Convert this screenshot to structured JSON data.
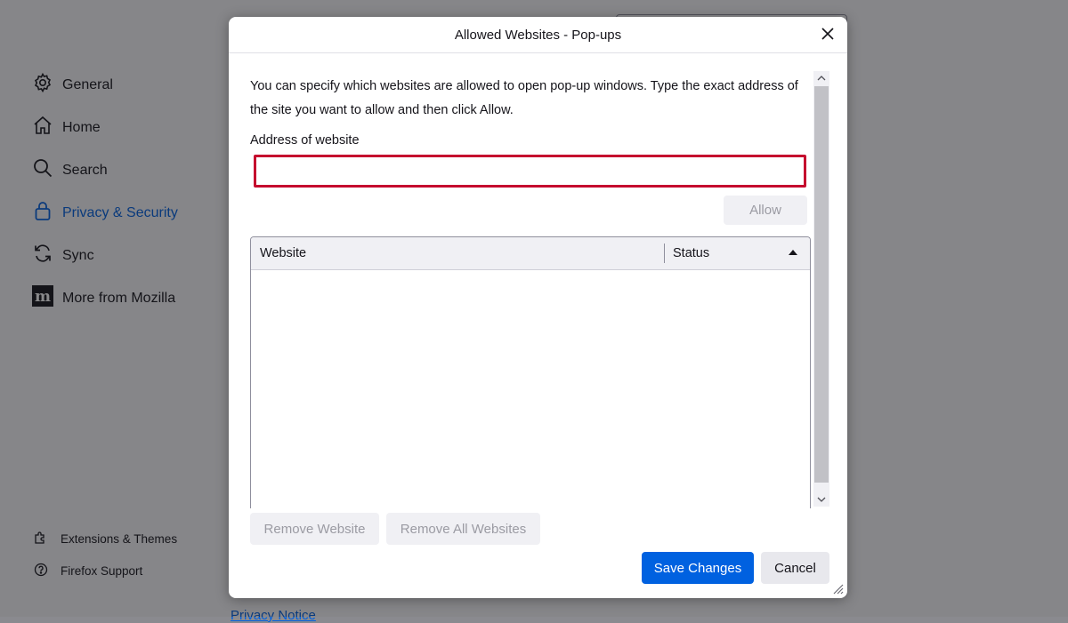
{
  "background": {
    "nav": {
      "items": [
        {
          "label": "General",
          "icon": "gear-icon"
        },
        {
          "label": "Home",
          "icon": "home-icon"
        },
        {
          "label": "Search",
          "icon": "search-icon"
        },
        {
          "label": "Privacy & Security",
          "icon": "lock-icon",
          "selected": true
        },
        {
          "label": "Sync",
          "icon": "sync-icon"
        },
        {
          "label": "More from Mozilla",
          "icon": "mozilla-icon"
        }
      ],
      "footer": [
        {
          "label": "Extensions & Themes",
          "icon": "puzzle-icon"
        },
        {
          "label": "Firefox Support",
          "icon": "help-icon"
        }
      ]
    },
    "link": "Privacy Notice"
  },
  "dialog": {
    "title": "Allowed Websites - Pop-ups",
    "description": "You can specify which websites are allowed to open pop-up windows. Type the exact address of the site you want to allow and then click Allow.",
    "address_label": "Address of website",
    "address_value": "",
    "allow_button": "Allow",
    "table": {
      "columns": [
        "Website",
        "Status"
      ],
      "rows": []
    },
    "remove_button": "Remove Website",
    "remove_all_button": "Remove All Websites",
    "save_button": "Save Changes",
    "cancel_button": "Cancel"
  },
  "colors": {
    "accent": "#0061e0",
    "focus_border": "#c50a2e"
  }
}
